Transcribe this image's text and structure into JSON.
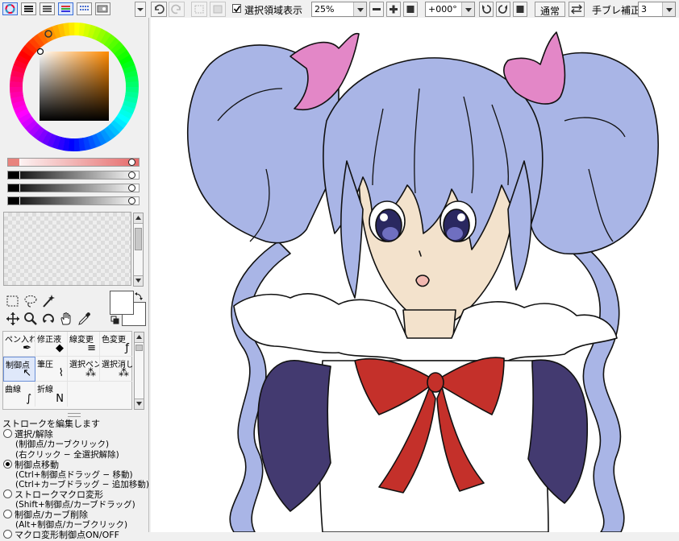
{
  "toolbar": {
    "selection_checkbox_label": "選択領域表示",
    "selection_checked": true,
    "zoom_value": "25%",
    "angle_value": "+000°",
    "blend_mode": "通常",
    "stabilizer_label": "手ブレ補正",
    "stabilizer_value": "3"
  },
  "view_buttons": [
    "color-wheel-view",
    "slider-view-1",
    "slider-view-2",
    "rgb-slider-view",
    "swatch-view",
    "scratch-view"
  ],
  "tool_groups": {
    "selection_tools": [
      "rect-select",
      "lasso-select",
      "magic-wand"
    ],
    "nav_tools": [
      "move",
      "zoom",
      "rotate",
      "hand",
      "eyedropper"
    ]
  },
  "tools": [
    {
      "label": "ペン入れ",
      "icon": "pen-icon"
    },
    {
      "label": "修正液",
      "icon": "eraser-icon"
    },
    {
      "label": "線変更",
      "icon": "lines-icon"
    },
    {
      "label": "色変更",
      "icon": "color-change-icon"
    },
    {
      "label": "制御点",
      "icon": "cursor-icon",
      "selected": true
    },
    {
      "label": "筆圧",
      "icon": "pressure-icon"
    },
    {
      "label": "選択ペン",
      "icon": "select-pen-icon"
    },
    {
      "label": "選択消し",
      "icon": "select-erase-icon"
    },
    {
      "label": "曲線",
      "icon": "curve-icon"
    },
    {
      "label": "折線",
      "icon": "polyline-icon"
    }
  ],
  "options": {
    "heading": "ストロークを編集します",
    "items": [
      {
        "label": "選択/解除",
        "checked": false,
        "subs": [
          "(制御点/カーブクリック)",
          "(右クリック − 全選択解除)"
        ]
      },
      {
        "label": "制御点移動",
        "checked": true,
        "subs": [
          "(Ctrl+制御点ドラッグ − 移動)",
          "(Ctrl+カーブドラッグ − 追加移動)"
        ]
      },
      {
        "label": "ストロークマクロ変形",
        "checked": false,
        "subs": [
          "(Shift+制御点/カーブドラッグ)"
        ]
      },
      {
        "label": "制御点/カーブ削除",
        "checked": false,
        "subs": [
          "(Alt+制御点/カーブクリック)"
        ]
      },
      {
        "label": "マクロ変形制御点ON/OFF",
        "checked": false,
        "subs": []
      }
    ]
  },
  "colors": {
    "hair": "#a9b5e6",
    "skin": "#f3e2cc",
    "ribbon_hair": "#e387c7",
    "bow": "#c4302a",
    "sleeve": "#433a70",
    "accent_selected": "#3a6fd8"
  }
}
